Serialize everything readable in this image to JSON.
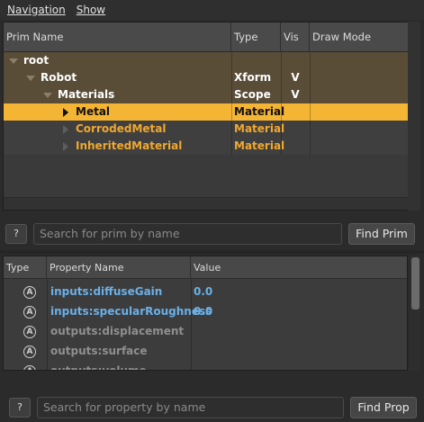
{
  "menu": {
    "navigation": "Navigation",
    "show": "Show"
  },
  "prim_tree": {
    "columns": [
      "Prim Name",
      "Type",
      "Vis",
      "Draw Mode"
    ],
    "rows": [
      {
        "name": "root",
        "type": "",
        "vis": "",
        "draw": ""
      },
      {
        "name": "Robot",
        "type": "Xform",
        "vis": "V",
        "draw": ""
      },
      {
        "name": "Materials",
        "type": "Scope",
        "vis": "V",
        "draw": ""
      },
      {
        "name": "Metal",
        "type": "Material",
        "vis": "",
        "draw": ""
      },
      {
        "name": "CorrodedMetal",
        "type": "Material",
        "vis": "",
        "draw": ""
      },
      {
        "name": "InheritedMaterial",
        "type": "Material",
        "vis": "",
        "draw": ""
      }
    ]
  },
  "prim_search": {
    "help": "?",
    "placeholder": "Search for prim by name",
    "button": "Find Prim"
  },
  "properties": {
    "columns": [
      "Type",
      "Property Name",
      "Value"
    ],
    "type_icon": "A",
    "rows": [
      {
        "name": "inputs:diffuseGain",
        "value": "0.0"
      },
      {
        "name": "inputs:specularRoughness",
        "value": "0.0"
      },
      {
        "name": "outputs:displacement",
        "value": ""
      },
      {
        "name": "outputs:surface",
        "value": ""
      },
      {
        "name": "outputs:volume",
        "value": ""
      }
    ]
  },
  "prop_search": {
    "help": "?",
    "placeholder": "Search for property by name",
    "button": "Find Prop"
  },
  "colors": {
    "selected_row": "#f4b434",
    "ancestor_row": "#594d38",
    "material_text": "#f0a830",
    "authored_property": "#6ab0e8"
  }
}
